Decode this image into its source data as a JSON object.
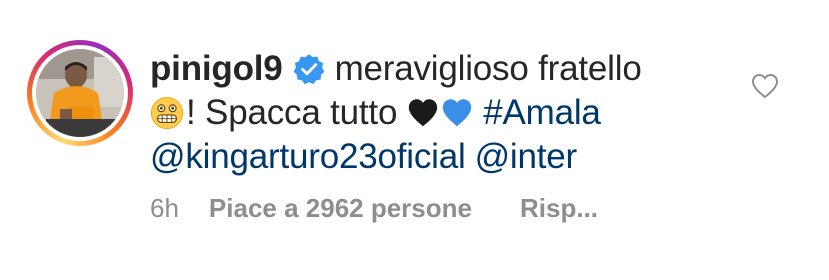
{
  "comment": {
    "username": "pinigol9",
    "verified": true,
    "text_part1": "meraviglioso fratello",
    "emoji_grimace": "grimacing-face-emoji",
    "text_part2": "! Spacca tutto",
    "hearts": [
      "black-heart-emoji",
      "blue-heart-emoji"
    ],
    "hashtag": "#Amala",
    "mention1": "@kingarturo23oficial",
    "mention2": "@inter",
    "time": "6h",
    "likes_label": "Piace a 2962 persone",
    "reply_label": "Risp..."
  },
  "icons": {
    "like": "heart-outline-icon",
    "verified": "verified-badge-icon"
  },
  "colors": {
    "username": "#262626",
    "text": "#262626",
    "link": "#00376b",
    "meta": "#8e8e8e",
    "verified": "#3897f0",
    "blue_heart": "#3a8fe8",
    "black_heart": "#1a1a1a"
  }
}
